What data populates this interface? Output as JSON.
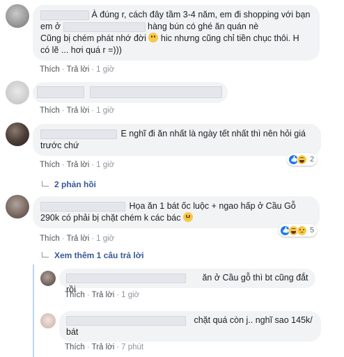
{
  "comments": [
    {
      "text_line1": "À đúng r, cách đây tầm 3-4 năm, em đi shopping với bạn",
      "text_line2_pre": "em ở",
      "text_line2_post": "hàng bún có ghé ăn quán nè",
      "text_line3": "Cũng bị chém phát nhớ đời",
      "text_line3_post": "hic nhưng cũng chỉ tiền chục thôi. H",
      "text_line4": "có lẽ ... hơi quá r =)))",
      "like_label": "Thích",
      "reply_label": "Trả lời",
      "time": "1 giờ"
    },
    {
      "like_label": "Thích",
      "reply_label": "Trả lời",
      "time": "1 giờ"
    },
    {
      "text_line1": "E nghĩ đi ăn nhất là ngày tết nhất thì nên hỏi giá",
      "text_line2": "trước chứ",
      "like_label": "Thích",
      "reply_label": "Trả lời",
      "time": "1 giờ",
      "reaction_count": "2",
      "replies_label": "2 phản hồi"
    },
    {
      "text_line1": "Họa ăn 1 bát ốc luộc + ngao hấp ở Cầu Gỗ",
      "text_line2": "290k có phải bị chặt chém k các bác",
      "like_label": "Thích",
      "reply_label": "Trả lời",
      "time": "1 giờ",
      "reaction_count": "5",
      "more_replies_label": "Xem thêm 1 câu trả lời"
    }
  ],
  "replies": [
    {
      "text": "ăn ở Cầu gỗ thì bt cũng đắt rồi",
      "like_label": "Thích",
      "reply_label": "Trả lời",
      "time": "1 giờ"
    },
    {
      "text_line1": "chặt quá còn j.. nghĩ sao 145k/",
      "text_line2": "bát",
      "like_label": "Thích",
      "reply_label": "Trả lời",
      "time": "7 phút"
    }
  ],
  "icons": {
    "reply_arrow": "reply-arrow-icon",
    "like": "like-reaction-icon",
    "haha": "haha-reaction-icon",
    "sad": "sad-reaction-icon"
  },
  "colors": {
    "bubble": "#f2f3f5",
    "link": "#385898",
    "meta": "#606770",
    "like_blue": "#1877f2"
  }
}
